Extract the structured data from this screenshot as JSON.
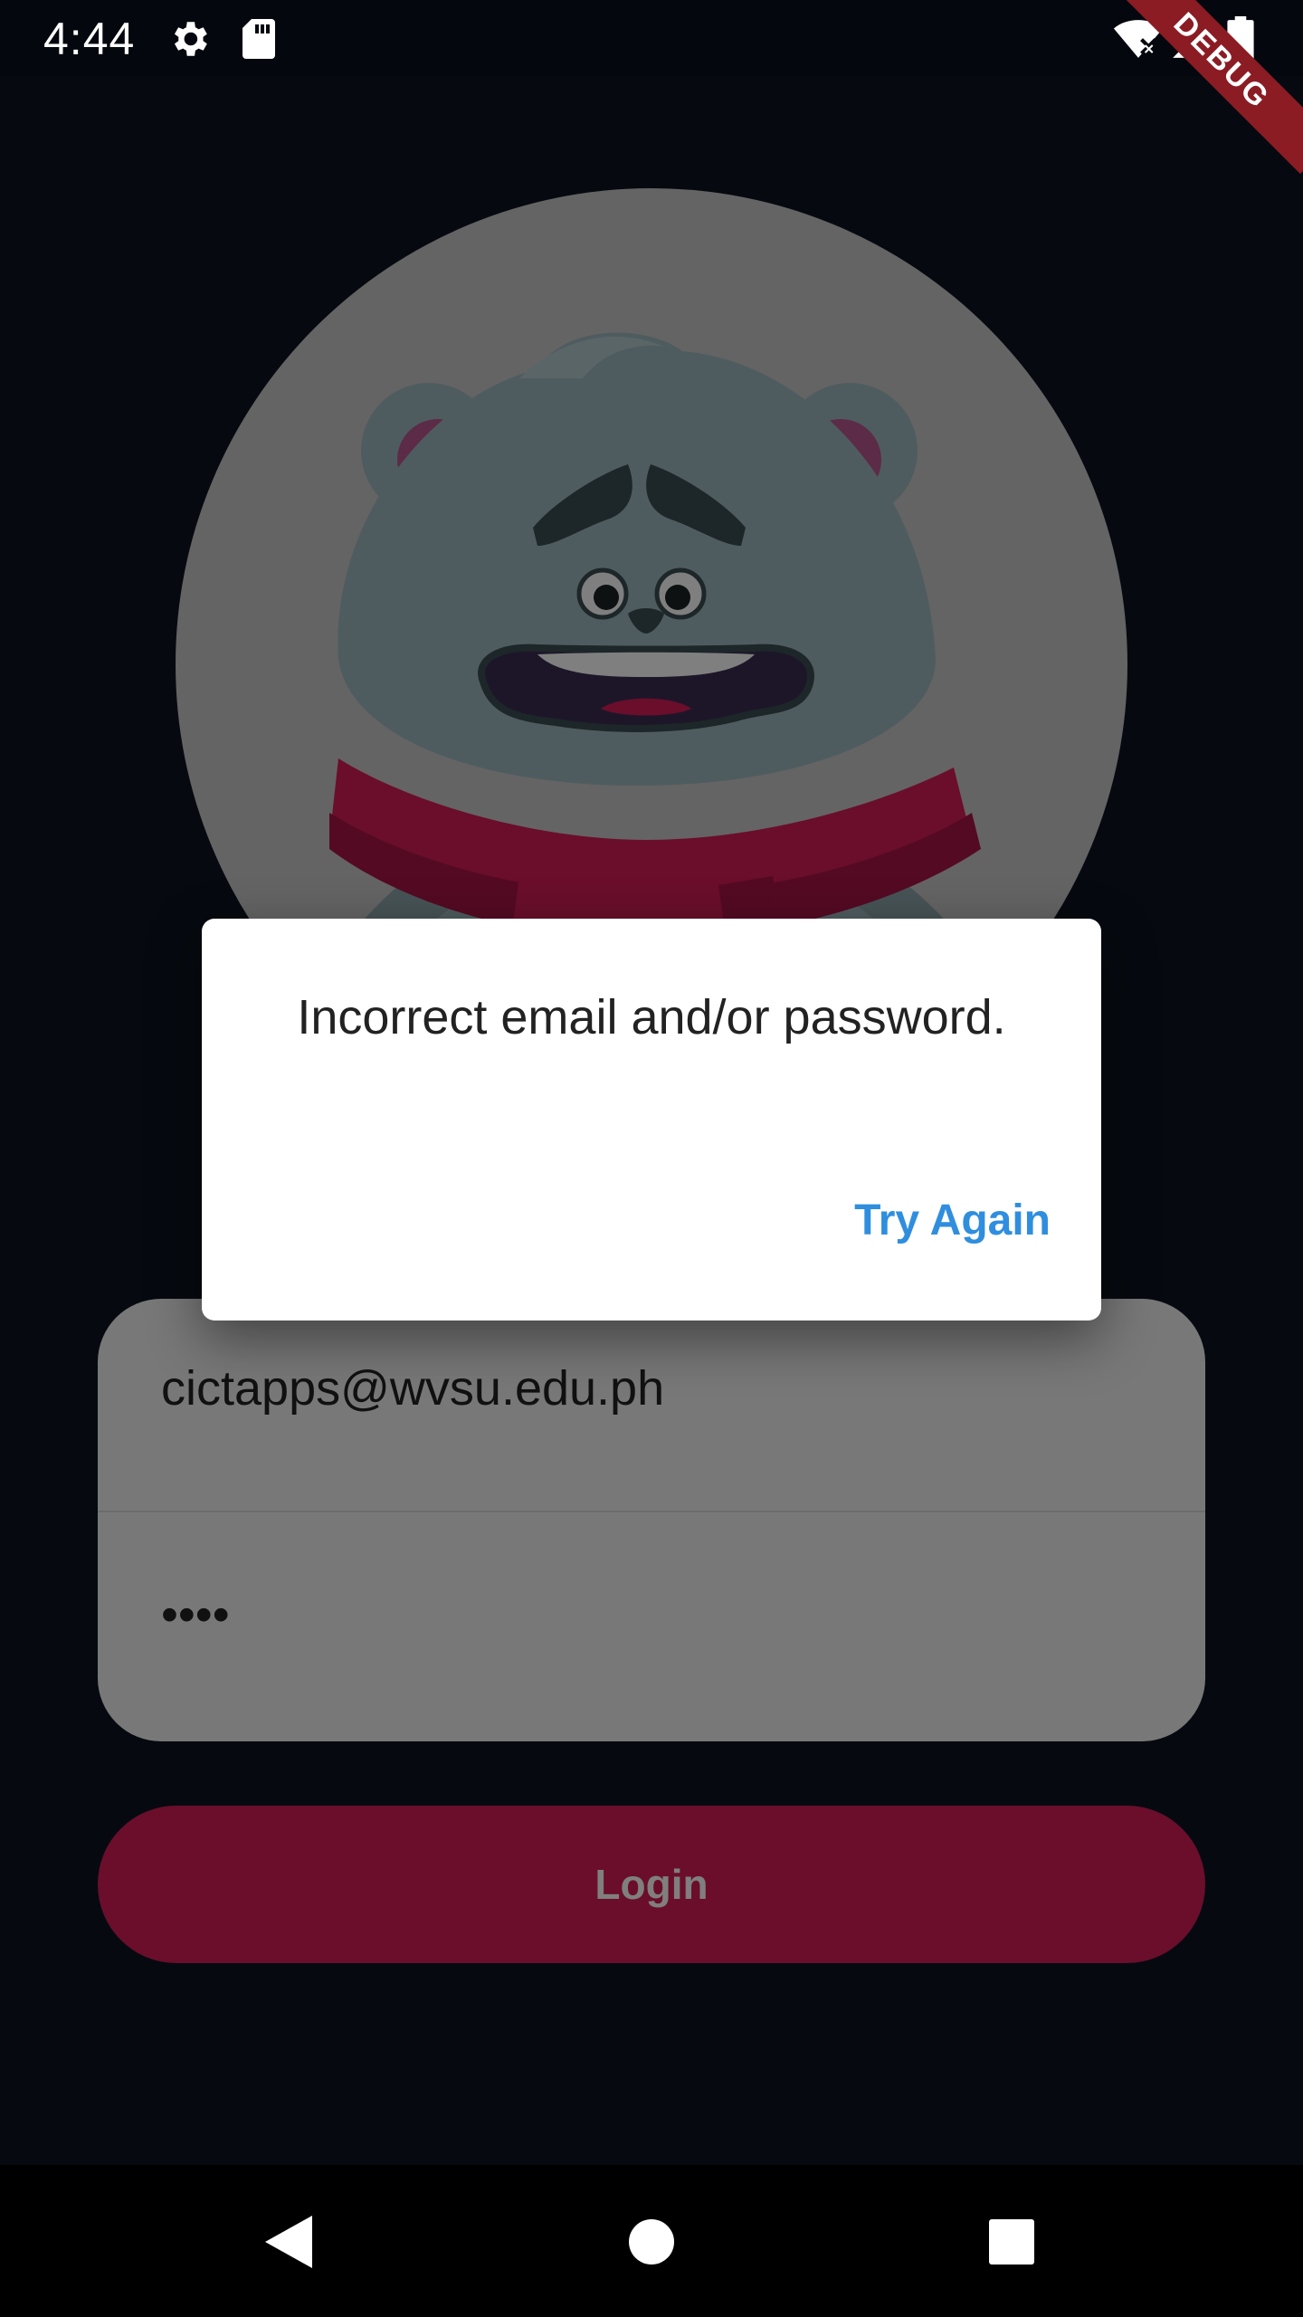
{
  "status_bar": {
    "time": "4:44",
    "icons": [
      "settings-icon",
      "sd-card-icon",
      "wifi-off-icon",
      "signal-icon",
      "battery-icon"
    ]
  },
  "debug_banner": "DEBUG",
  "login_form": {
    "email_value": "cictapps@wvsu.edu.ph",
    "password_value": "••••",
    "login_label": "Login"
  },
  "dialog": {
    "message": "Incorrect email and/or password.",
    "action_label": "Try Again"
  },
  "colors": {
    "background": "#0c1420",
    "accent": "#d51d57",
    "dialog_action": "#2f8ede",
    "bear_fur": "#9fb8be",
    "scarf": "#d51d57"
  },
  "nav_bar": {
    "icons": [
      "back-icon",
      "home-icon",
      "recents-icon"
    ]
  }
}
